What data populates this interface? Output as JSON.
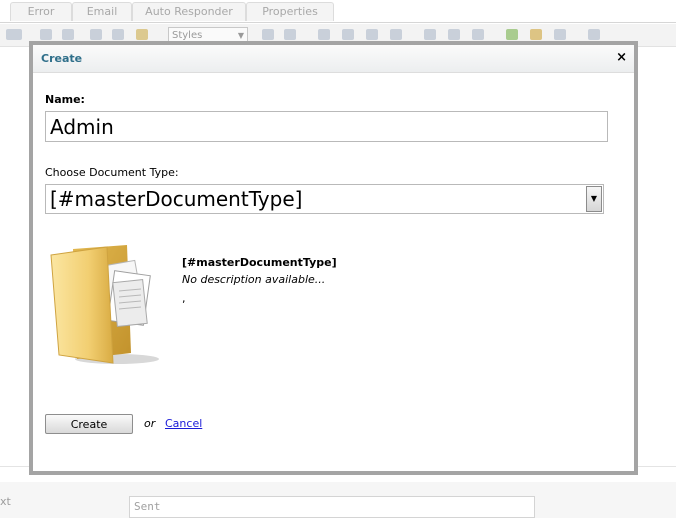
{
  "background": {
    "tabs": [
      {
        "label": "Error"
      },
      {
        "label": "Email"
      },
      {
        "label": "Auto Responder"
      },
      {
        "label": "Properties"
      }
    ],
    "toolbar": {
      "styles_select": "Styles"
    },
    "field_label": "xt",
    "field_value": "Sent"
  },
  "modal": {
    "title": "Create",
    "close_glyph": "×",
    "name_label": "Name:",
    "name_value": "Admin",
    "type_label": "Choose Document Type:",
    "type_selected": "[#masterDocumentType]",
    "doc_name": "[#masterDocumentType]",
    "doc_description": "No description available...",
    "doc_extra": ",",
    "create_button": "Create",
    "or_text": "or",
    "cancel_link": "Cancel",
    "icon": "folder-with-documents-icon"
  },
  "colors": {
    "title": "#2f6f8a",
    "link": "#1a1ad8",
    "modal_border": "#a4a4a4"
  }
}
